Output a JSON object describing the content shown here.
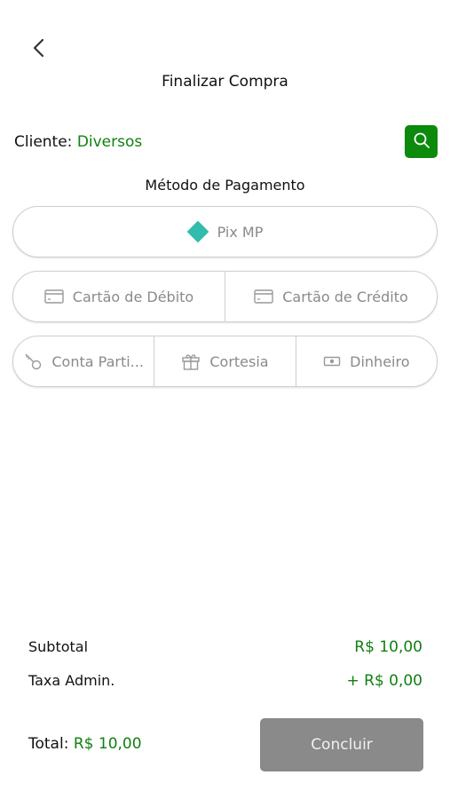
{
  "header": {
    "back_icon": "chevron-left-icon",
    "title": "Finalizar Compra"
  },
  "client": {
    "label": "Cliente:",
    "value": "Diversos",
    "search_icon": "search-icon"
  },
  "payment": {
    "title": "Método de Pagamento",
    "methods": [
      {
        "label": "Pix MP",
        "icon": "pix-icon"
      },
      {
        "label": "Cartão de Débito",
        "icon": "credit-card-icon"
      },
      {
        "label": "Cartão de Crédito",
        "icon": "credit-card-icon"
      },
      {
        "label": "Conta Parti...",
        "icon": "key-icon"
      },
      {
        "label": "Cortesia",
        "icon": "gift-icon"
      },
      {
        "label": "Dinheiro",
        "icon": "cash-icon"
      }
    ]
  },
  "summary": {
    "subtotal_label": "Subtotal",
    "subtotal_value": "R$ 10,00",
    "fee_label": "Taxa Admin.",
    "fee_value": "+ R$ 0,00",
    "total_label": "Total:",
    "total_value": "R$ 10,00",
    "conclude_label": "Concluir"
  },
  "colors": {
    "accent_green": "#0b8a0b",
    "text_green": "#118011",
    "pix_teal": "#32bcad",
    "disabled_button": "#8a8a8a"
  }
}
